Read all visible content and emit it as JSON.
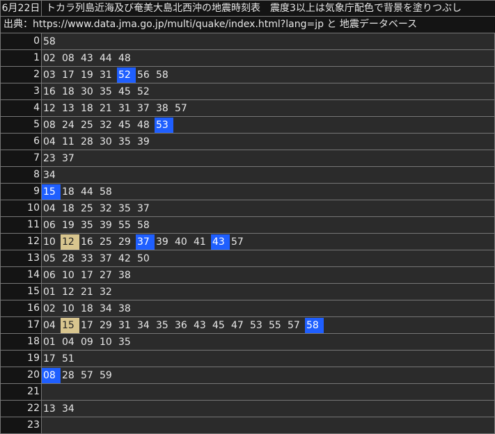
{
  "header": {
    "date": "6月22日",
    "title": "トカラ列島近海及び奄美大島北西沖の地震時刻表　震度3以上は気象庁配色で背景を塗りつぶし",
    "source": "出典：https://www.data.jma.go.jp/multi/quake/index.html?lang=jp と 地震データベース"
  },
  "colors": {
    "shindo3_bg": "#1f5fff",
    "shindo4_bg": "#d8c58e"
  },
  "hours": [
    {
      "hour": "0",
      "minutes": [
        {
          "m": "58"
        }
      ]
    },
    {
      "hour": "1",
      "minutes": [
        {
          "m": "02"
        },
        {
          "m": "08"
        },
        {
          "m": "43"
        },
        {
          "m": "44"
        },
        {
          "m": "48"
        }
      ]
    },
    {
      "hour": "2",
      "minutes": [
        {
          "m": "03"
        },
        {
          "m": "17"
        },
        {
          "m": "19"
        },
        {
          "m": "31"
        },
        {
          "m": "52",
          "c": "blue"
        },
        {
          "m": "56"
        },
        {
          "m": "58"
        }
      ]
    },
    {
      "hour": "3",
      "minutes": [
        {
          "m": "16"
        },
        {
          "m": "18"
        },
        {
          "m": "30"
        },
        {
          "m": "35"
        },
        {
          "m": "45"
        },
        {
          "m": "52"
        }
      ]
    },
    {
      "hour": "4",
      "minutes": [
        {
          "m": "12"
        },
        {
          "m": "13"
        },
        {
          "m": "18"
        },
        {
          "m": "21"
        },
        {
          "m": "31"
        },
        {
          "m": "37"
        },
        {
          "m": "38"
        },
        {
          "m": "57"
        }
      ]
    },
    {
      "hour": "5",
      "minutes": [
        {
          "m": "08"
        },
        {
          "m": "24"
        },
        {
          "m": "25"
        },
        {
          "m": "32"
        },
        {
          "m": "45"
        },
        {
          "m": "48"
        },
        {
          "m": "53",
          "c": "blue"
        }
      ]
    },
    {
      "hour": "6",
      "minutes": [
        {
          "m": "04"
        },
        {
          "m": "11"
        },
        {
          "m": "28"
        },
        {
          "m": "30"
        },
        {
          "m": "35"
        },
        {
          "m": "39"
        }
      ]
    },
    {
      "hour": "7",
      "minutes": [
        {
          "m": "23"
        },
        {
          "m": "37"
        }
      ]
    },
    {
      "hour": "8",
      "minutes": [
        {
          "m": "34"
        }
      ]
    },
    {
      "hour": "9",
      "minutes": [
        {
          "m": "15",
          "c": "blue"
        },
        {
          "m": "18"
        },
        {
          "m": "44"
        },
        {
          "m": "58"
        }
      ]
    },
    {
      "hour": "10",
      "minutes": [
        {
          "m": "04"
        },
        {
          "m": "18"
        },
        {
          "m": "25"
        },
        {
          "m": "32"
        },
        {
          "m": "35"
        },
        {
          "m": "37"
        }
      ]
    },
    {
      "hour": "11",
      "minutes": [
        {
          "m": "06"
        },
        {
          "m": "19"
        },
        {
          "m": "35"
        },
        {
          "m": "39"
        },
        {
          "m": "55"
        },
        {
          "m": "58"
        }
      ]
    },
    {
      "hour": "12",
      "minutes": [
        {
          "m": "10"
        },
        {
          "m": "12",
          "c": "tan"
        },
        {
          "m": "16"
        },
        {
          "m": "25"
        },
        {
          "m": "29"
        },
        {
          "m": "37",
          "c": "blue"
        },
        {
          "m": "39"
        },
        {
          "m": "40"
        },
        {
          "m": "41"
        },
        {
          "m": "43",
          "c": "blue"
        },
        {
          "m": "57"
        }
      ]
    },
    {
      "hour": "13",
      "minutes": [
        {
          "m": "05"
        },
        {
          "m": "28"
        },
        {
          "m": "33"
        },
        {
          "m": "37"
        },
        {
          "m": "42"
        },
        {
          "m": "50"
        }
      ]
    },
    {
      "hour": "14",
      "minutes": [
        {
          "m": "06"
        },
        {
          "m": "10"
        },
        {
          "m": "17"
        },
        {
          "m": "27"
        },
        {
          "m": "38"
        }
      ]
    },
    {
      "hour": "15",
      "minutes": [
        {
          "m": "01"
        },
        {
          "m": "12"
        },
        {
          "m": "21"
        },
        {
          "m": "32"
        }
      ]
    },
    {
      "hour": "16",
      "minutes": [
        {
          "m": "02"
        },
        {
          "m": "10"
        },
        {
          "m": "18"
        },
        {
          "m": "34"
        },
        {
          "m": "38"
        }
      ]
    },
    {
      "hour": "17",
      "minutes": [
        {
          "m": "04"
        },
        {
          "m": "15",
          "c": "tan"
        },
        {
          "m": "17"
        },
        {
          "m": "29"
        },
        {
          "m": "31"
        },
        {
          "m": "34"
        },
        {
          "m": "35"
        },
        {
          "m": "36"
        },
        {
          "m": "43"
        },
        {
          "m": "45"
        },
        {
          "m": "47"
        },
        {
          "m": "53"
        },
        {
          "m": "55"
        },
        {
          "m": "57"
        },
        {
          "m": "58",
          "c": "blue"
        }
      ]
    },
    {
      "hour": "18",
      "minutes": [
        {
          "m": "01"
        },
        {
          "m": "04"
        },
        {
          "m": "09"
        },
        {
          "m": "10"
        },
        {
          "m": "35"
        }
      ]
    },
    {
      "hour": "19",
      "minutes": [
        {
          "m": "17"
        },
        {
          "m": "51"
        }
      ]
    },
    {
      "hour": "20",
      "minutes": [
        {
          "m": "08",
          "c": "blue"
        },
        {
          "m": "28"
        },
        {
          "m": "57"
        },
        {
          "m": "59"
        }
      ]
    },
    {
      "hour": "21",
      "minutes": []
    },
    {
      "hour": "22",
      "minutes": [
        {
          "m": "13"
        },
        {
          "m": "34"
        }
      ]
    },
    {
      "hour": "23",
      "minutes": []
    }
  ]
}
